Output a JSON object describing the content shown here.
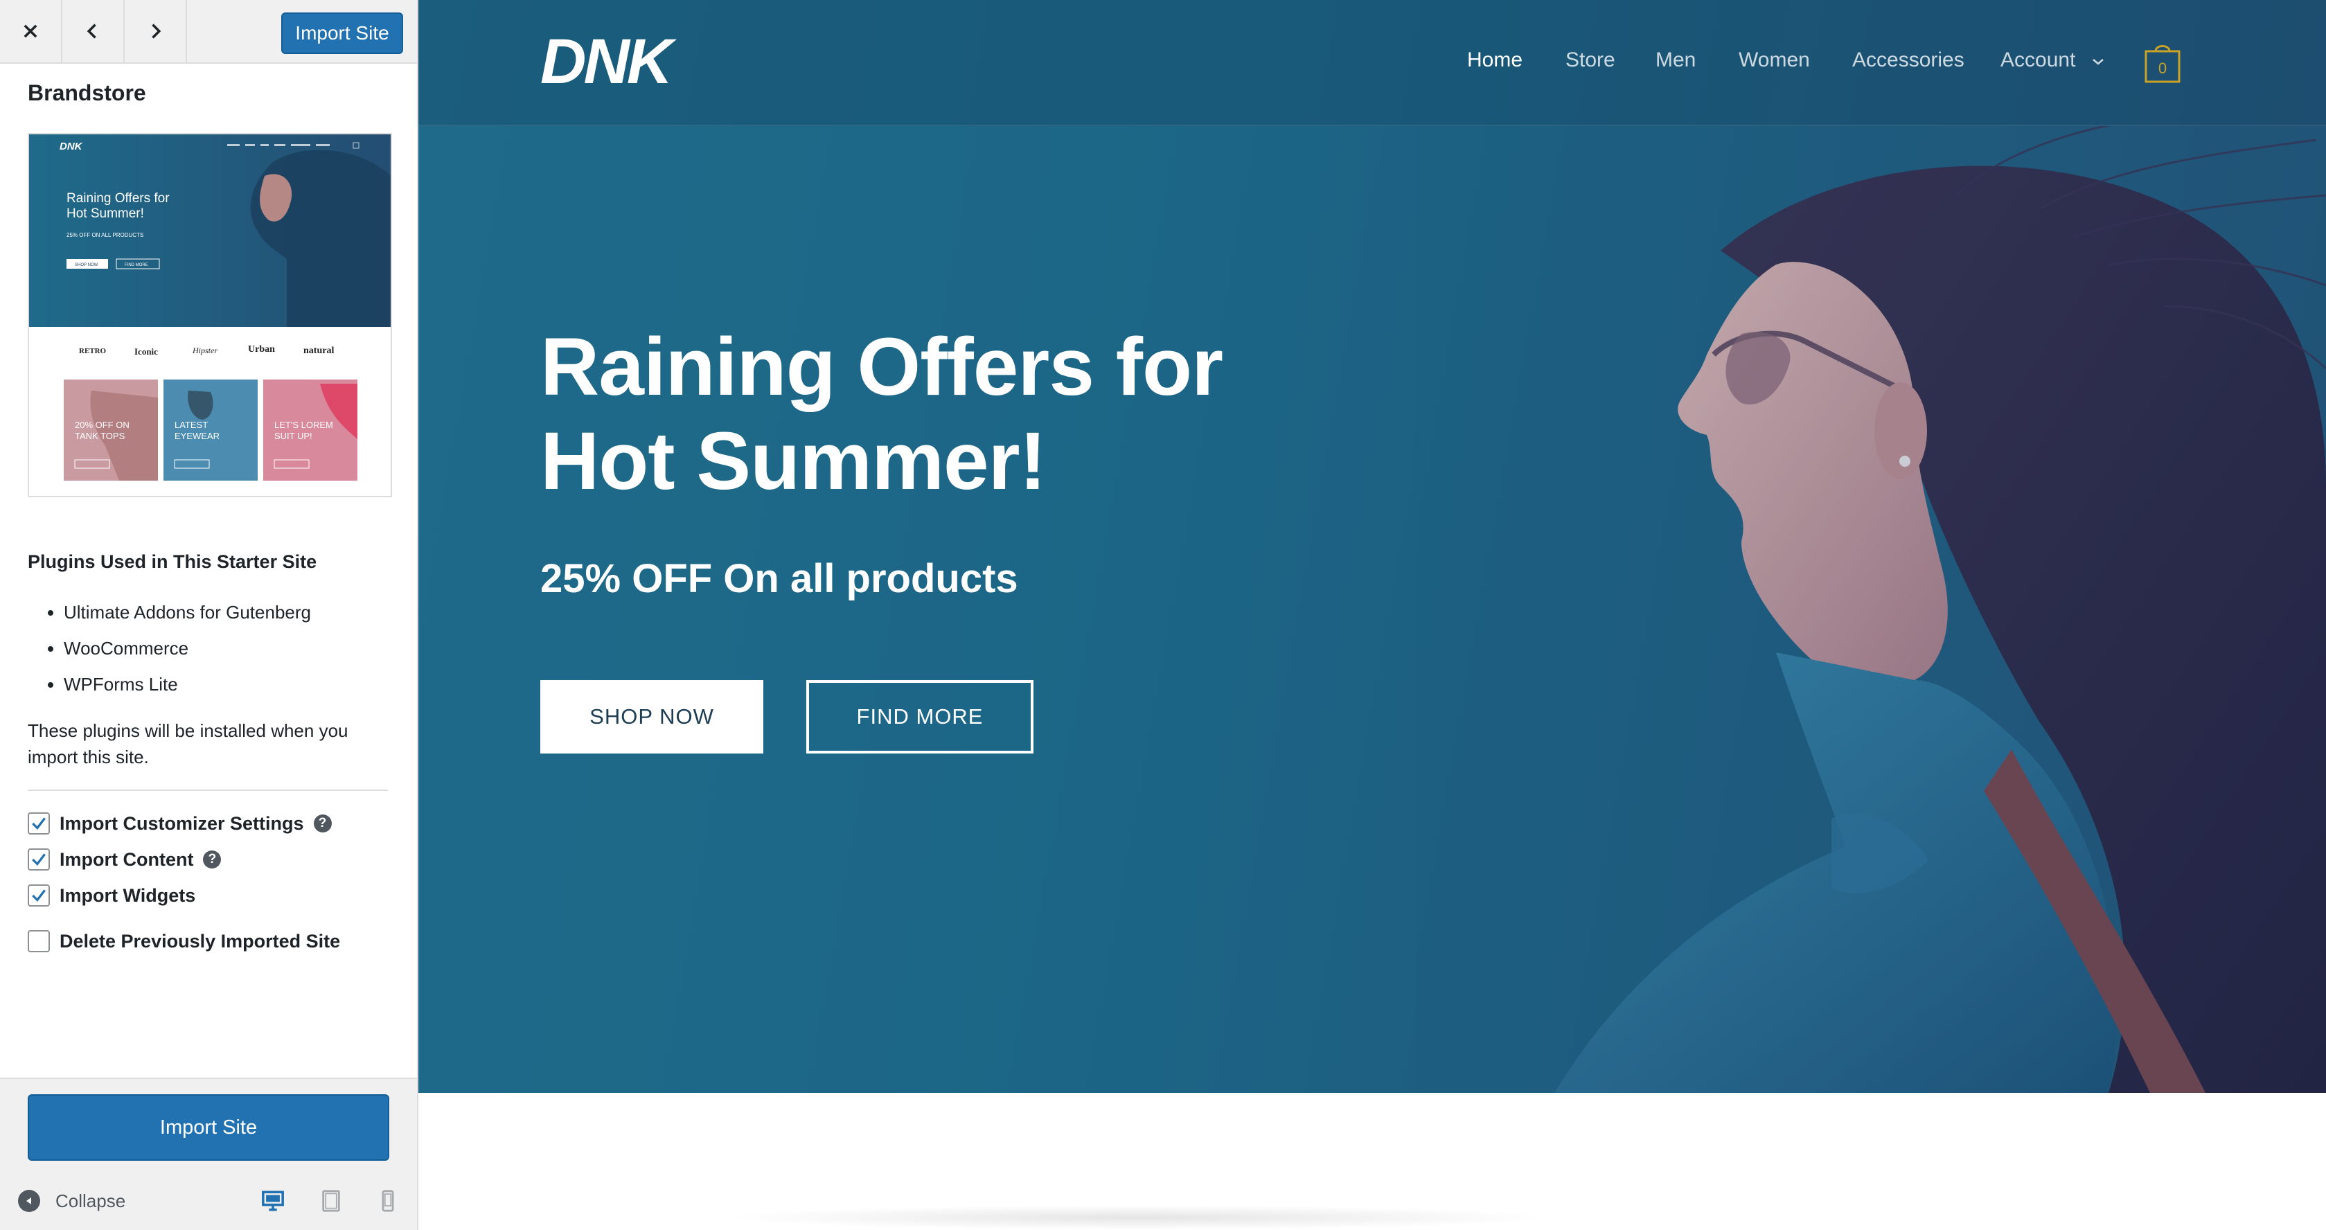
{
  "sidebar": {
    "close_icon": "close-icon",
    "prev_icon": "chevron-left-icon",
    "next_icon": "chevron-right-icon",
    "top_import_label": "Import Site",
    "site_title": "Brandstore",
    "thumbnail": {
      "logo": "DNK",
      "hero_title": "Raining Offers for Hot Summer!",
      "hero_sub": "25% OFF ON ALL PRODUCTS",
      "btn_shop": "SHOP NOW",
      "btn_find": "FIND MORE",
      "brands": [
        "RETRO",
        "Iconic",
        "Hipster",
        "Urban",
        "natural"
      ],
      "cards": [
        {
          "label": "20% OFF ON TANK TOPS",
          "color": "#c99aa0"
        },
        {
          "label": "LATEST EYEWEAR",
          "color": "#4b8cb0"
        },
        {
          "label": "LET'S LOREM SUIT UP!",
          "color": "#d88a9c"
        }
      ]
    },
    "plugins_heading": "Plugins Used in This Starter Site",
    "plugins": [
      "Ultimate Addons for Gutenberg",
      "WooCommerce",
      "WPForms Lite"
    ],
    "plugins_note": "These plugins will be installed when you import this site.",
    "options": [
      {
        "label": "Import Customizer Settings",
        "checked": true,
        "help": true
      },
      {
        "label": "Import Content",
        "checked": true,
        "help": true
      },
      {
        "label": "Import Widgets",
        "checked": true,
        "help": false
      },
      {
        "label": "Delete Previously Imported Site",
        "checked": false,
        "help": false
      }
    ],
    "help_glyph": "?",
    "bottom_import_label": "Import Site",
    "collapse_label": "Collapse",
    "devices": [
      "desktop-icon",
      "tablet-icon",
      "mobile-icon"
    ],
    "accent": "#2271b1"
  },
  "preview": {
    "logo": "DNK",
    "nav": [
      "Home",
      "Store",
      "Men",
      "Women",
      "Accessories",
      "Account"
    ],
    "cart_count": "0",
    "hero_title_line1": "Raining Offers for",
    "hero_title_line2": "Hot Summer!",
    "hero_subtitle": "25% OFF On all products",
    "btn_shop": "SHOP NOW",
    "btn_find": "FIND MORE",
    "hero_color": "#1d6384",
    "cart_color": "#c9a227"
  }
}
